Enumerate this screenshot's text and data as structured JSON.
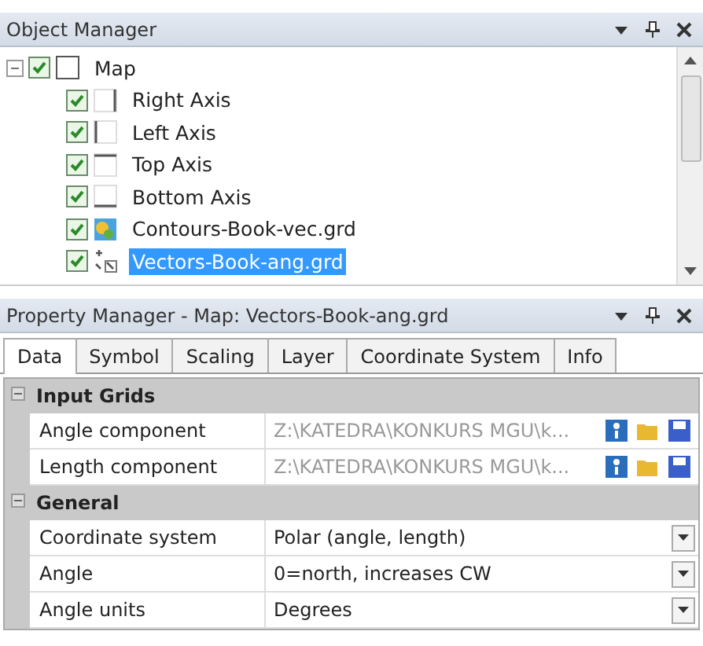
{
  "object_manager": {
    "title": "Object Manager",
    "tree": [
      {
        "label": "Map",
        "checked": true,
        "expanded": true,
        "selected": false,
        "kind": "map",
        "children": [
          {
            "label": "Right Axis",
            "checked": true,
            "selected": false,
            "kind": "axis-right"
          },
          {
            "label": "Left Axis",
            "checked": true,
            "selected": false,
            "kind": "axis-left"
          },
          {
            "label": "Top Axis",
            "checked": true,
            "selected": false,
            "kind": "axis-top"
          },
          {
            "label": "Bottom Axis",
            "checked": true,
            "selected": false,
            "kind": "axis-bottom"
          },
          {
            "label": "Contours-Book-vec.grd",
            "checked": true,
            "selected": false,
            "kind": "contour"
          },
          {
            "label": "Vectors-Book-ang.grd",
            "checked": true,
            "selected": true,
            "kind": "vector"
          }
        ]
      }
    ]
  },
  "property_manager": {
    "title": "Property Manager - Map: Vectors-Book-ang.grd",
    "tabs": [
      {
        "label": "Data",
        "selected": true
      },
      {
        "label": "Symbol",
        "selected": false
      },
      {
        "label": "Scaling",
        "selected": false
      },
      {
        "label": "Layer",
        "selected": false
      },
      {
        "label": "Coordinate System",
        "selected": false
      },
      {
        "label": "Info",
        "selected": false
      }
    ],
    "sections": [
      {
        "title": "Input Grids",
        "expanded": true,
        "rows": [
          {
            "label": "Angle component",
            "value": "Z:\\KATEDRA\\KONKURS MGU\\k...",
            "kind": "file"
          },
          {
            "label": "Length component",
            "value": "Z:\\KATEDRA\\KONKURS MGU\\k...",
            "kind": "file"
          }
        ]
      },
      {
        "title": "General",
        "expanded": true,
        "rows": [
          {
            "label": "Coordinate system",
            "value": "Polar (angle, length)",
            "kind": "dropdown"
          },
          {
            "label": "Angle",
            "value": "0=north, increases CW",
            "kind": "dropdown"
          },
          {
            "label": "Angle units",
            "value": "Degrees",
            "kind": "dropdown"
          }
        ]
      }
    ]
  }
}
